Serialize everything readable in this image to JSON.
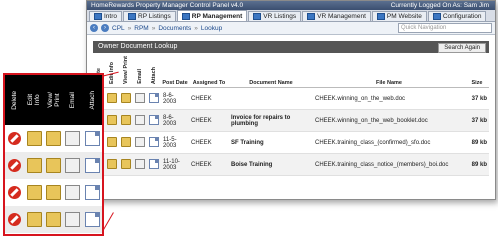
{
  "window": {
    "title": "HomeRewards Property Manager Control Panel v4.0",
    "status": "Currently Logged On As: Sam Jim"
  },
  "tabs": [
    {
      "label": "Intro",
      "active": false
    },
    {
      "label": "RP Listings",
      "active": false
    },
    {
      "label": "RP Management",
      "active": true
    },
    {
      "label": "VR Listings",
      "active": false
    },
    {
      "label": "VR Management",
      "active": false
    },
    {
      "label": "PM Website",
      "active": false
    },
    {
      "label": "Configuration",
      "active": false
    }
  ],
  "nav": {
    "back_icon": "back-arrow-icon",
    "forward_icon": "forward-arrow-icon",
    "breadcrumb": [
      "CPL",
      "RPM",
      "Documents",
      "Lookup"
    ],
    "separator": "»",
    "search_placeholder": "Quick Navigation"
  },
  "panel": {
    "title": "Owner Document Lookup",
    "search_again": "Search Again"
  },
  "table": {
    "headers": {
      "delete": "Delete",
      "edit_info": "Edit Info",
      "view_print": "View/ Print",
      "email": "Email",
      "attach": "Attach",
      "post_date": "Post Date",
      "assigned_to": "Assigned To",
      "document_name": "Document Name",
      "file_name": "File Name",
      "size": "Size"
    },
    "rows": [
      {
        "post_date": "8-6-2003",
        "assigned_to": "CHEEK",
        "document_name": "",
        "file_name": "CHEEK.winning_on_the_web.doc",
        "size": "37 kb"
      },
      {
        "post_date": "8-6-2003",
        "assigned_to": "CHEEK",
        "document_name": "Invoice for repairs to plumbing",
        "file_name": "CHEEK.winning_on_the_web_booklet.doc",
        "size": "37 kb"
      },
      {
        "post_date": "11-5-2003",
        "assigned_to": "CHEEK",
        "document_name": "SF Training",
        "file_name": "CHEEK.training_class_(confirmed)_sfo.doc",
        "size": "89 kb"
      },
      {
        "post_date": "11-10-2003",
        "assigned_to": "CHEEK",
        "document_name": "Boise Training",
        "file_name": "CHEEK.training_class_notice_(members)_boi.doc",
        "size": "89 kb"
      }
    ]
  },
  "zoom": {
    "headers": [
      "Delete",
      "Edit\nInfo",
      "View/\nPrint",
      "Email",
      "Attach"
    ],
    "row_count": 4,
    "accent_color": "#d7141e"
  }
}
